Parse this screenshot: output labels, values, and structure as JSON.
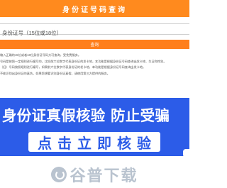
{
  "header": {
    "title": "身份证号码查询"
  },
  "search": {
    "placeholder": "身份证号（15位或18位）",
    "button_label": "查询"
  },
  "notes": [
    "输入正确的15位或者18位身份证号码方可查询，受免费服务。",
    "号码是按照一定规则进行编写的，比如前六位数字代表身份证的发卡地，本功能是根据身份证号码查询出发卡地、生日和性别。",
    "（旧）号码按照规则进行编写，如果前六位数字代表身份证的发卡地，本功能是根据身份证号码查询出发卡地。",
    "不能识别出身份证的真伪，如果您想要识别身份证真假，请使用第三方提供的服务。"
  ],
  "banner": {
    "title": "身份证真假核验 防止受骗",
    "button_label": "点击立即核验"
  },
  "watermark": {
    "text": "谷普下载"
  },
  "colors": {
    "header_bg": "#ff8a1e",
    "button_bg": "#ff7f1b",
    "banner_bg": "#2c5ce8",
    "watermark": "#b9c3cf"
  }
}
